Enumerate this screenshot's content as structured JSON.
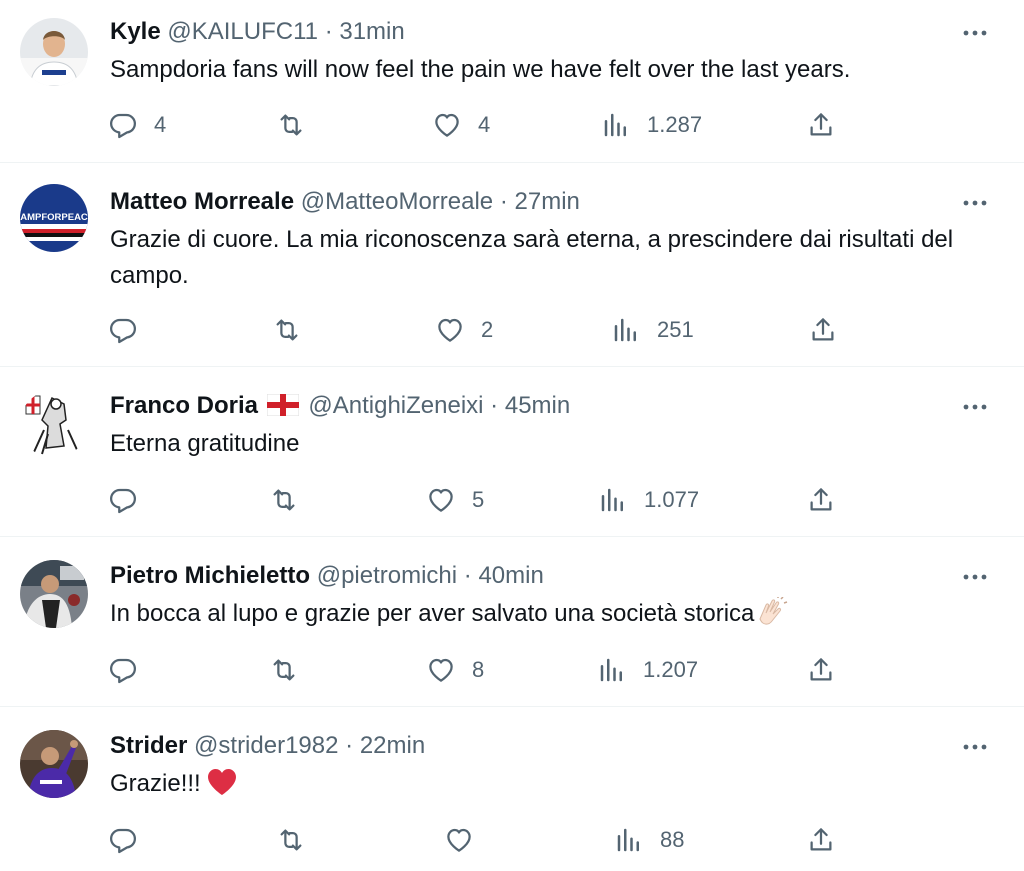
{
  "tweets": [
    {
      "name": "Kyle",
      "handle": "@KAILUFC11",
      "dot": "·",
      "time": "31min",
      "text": "Sampdoria fans will now feel the pain we have felt over the last years.",
      "replies": "4",
      "retweets": "",
      "likes": "4",
      "views": "1.287",
      "avatar_icon": "player-avatar"
    },
    {
      "name": "Matteo Morreale",
      "handle": "@MatteoMorreale",
      "dot": "·",
      "time": "27min",
      "text": "Grazie di cuore. La mia riconoscenza sarà eterna, a prescindere dai risultati del campo.",
      "replies": "",
      "retweets": "",
      "likes": "2",
      "views": "251",
      "avatar_icon": "sampforpeace-avatar",
      "avatar_text": "SAMPFORPEACE"
    },
    {
      "name": "Franco Doria",
      "handle": "@AntighiZeneixi",
      "dot": "·",
      "time": "45min",
      "text": "Eterna gratitudine",
      "replies": "",
      "retweets": "",
      "likes": "5",
      "views": "1.077",
      "avatar_icon": "crusader-avatar",
      "name_emoji": "england-flag-icon"
    },
    {
      "name": "Pietro Michieletto",
      "handle": "@pietromichi",
      "dot": "·",
      "time": "40min",
      "text": "In bocca al lupo e grazie per aver salvato una società storica",
      "replies": "",
      "retweets": "",
      "likes": "8",
      "views": "1.207",
      "avatar_icon": "photo-avatar",
      "text_emoji": "clapping-hands-icon"
    },
    {
      "name": "Strider",
      "handle": "@strider1982",
      "dot": "·",
      "time": "22min",
      "text": "Grazie!!!",
      "replies": "",
      "retweets": "",
      "likes": "",
      "views": "88",
      "avatar_icon": "player-purple-avatar",
      "text_emoji": "red-heart-icon"
    }
  ],
  "colors": {
    "text": "#0f1419",
    "muted": "#536471",
    "divider": "#eff3f4",
    "heart": "#dd2e44"
  }
}
